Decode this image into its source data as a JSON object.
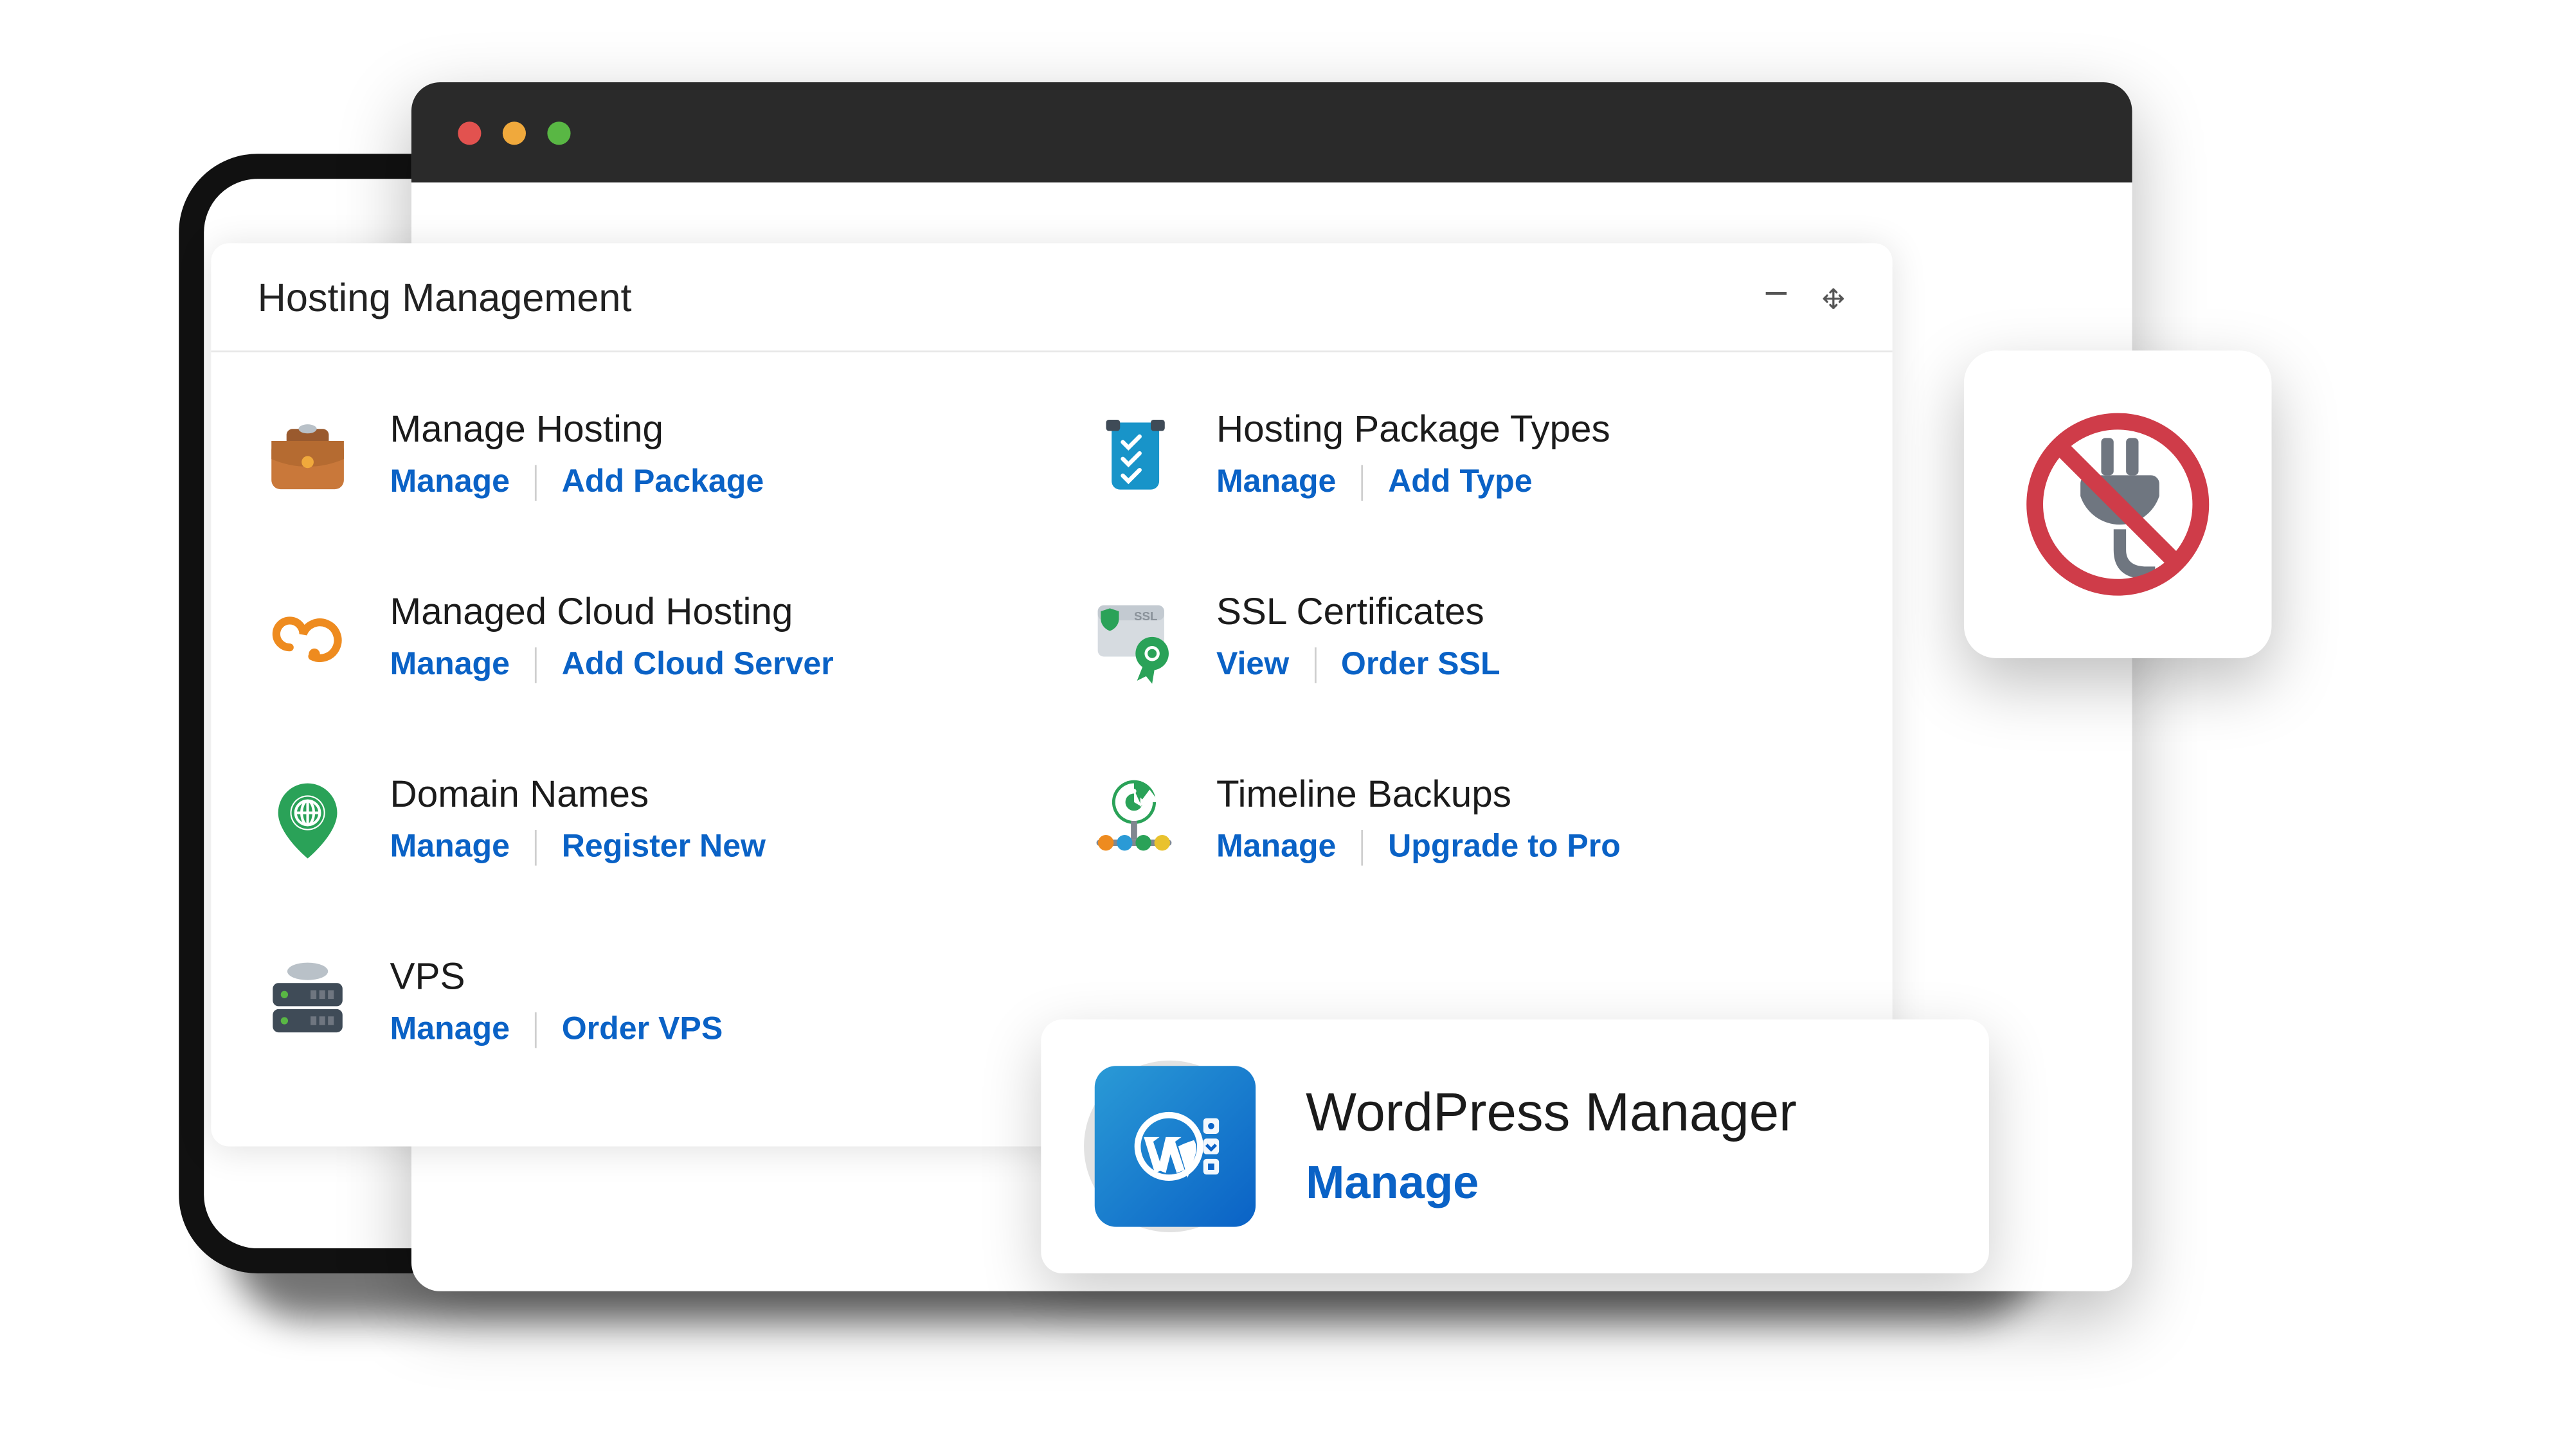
{
  "panel": {
    "title": "Hosting Management"
  },
  "tiles": {
    "manage_hosting": {
      "title": "Manage Hosting",
      "link1": "Manage",
      "link2": "Add Package"
    },
    "package_types": {
      "title": "Hosting Package Types",
      "link1": "Manage",
      "link2": "Add Type"
    },
    "cloud_hosting": {
      "title": "Managed Cloud Hosting",
      "link1": "Manage",
      "link2": "Add Cloud Server"
    },
    "ssl": {
      "title": "SSL Certificates",
      "link1": "View",
      "link2": "Order SSL"
    },
    "domains": {
      "title": "Domain Names",
      "link1": "Manage",
      "link2": "Register New"
    },
    "backups": {
      "title": "Timeline Backups",
      "link1": "Manage",
      "link2": "Upgrade to Pro"
    },
    "vps": {
      "title": "VPS",
      "link1": "Manage",
      "link2": "Order VPS"
    }
  },
  "feature": {
    "title": "WordPress Manager",
    "link": "Manage"
  }
}
